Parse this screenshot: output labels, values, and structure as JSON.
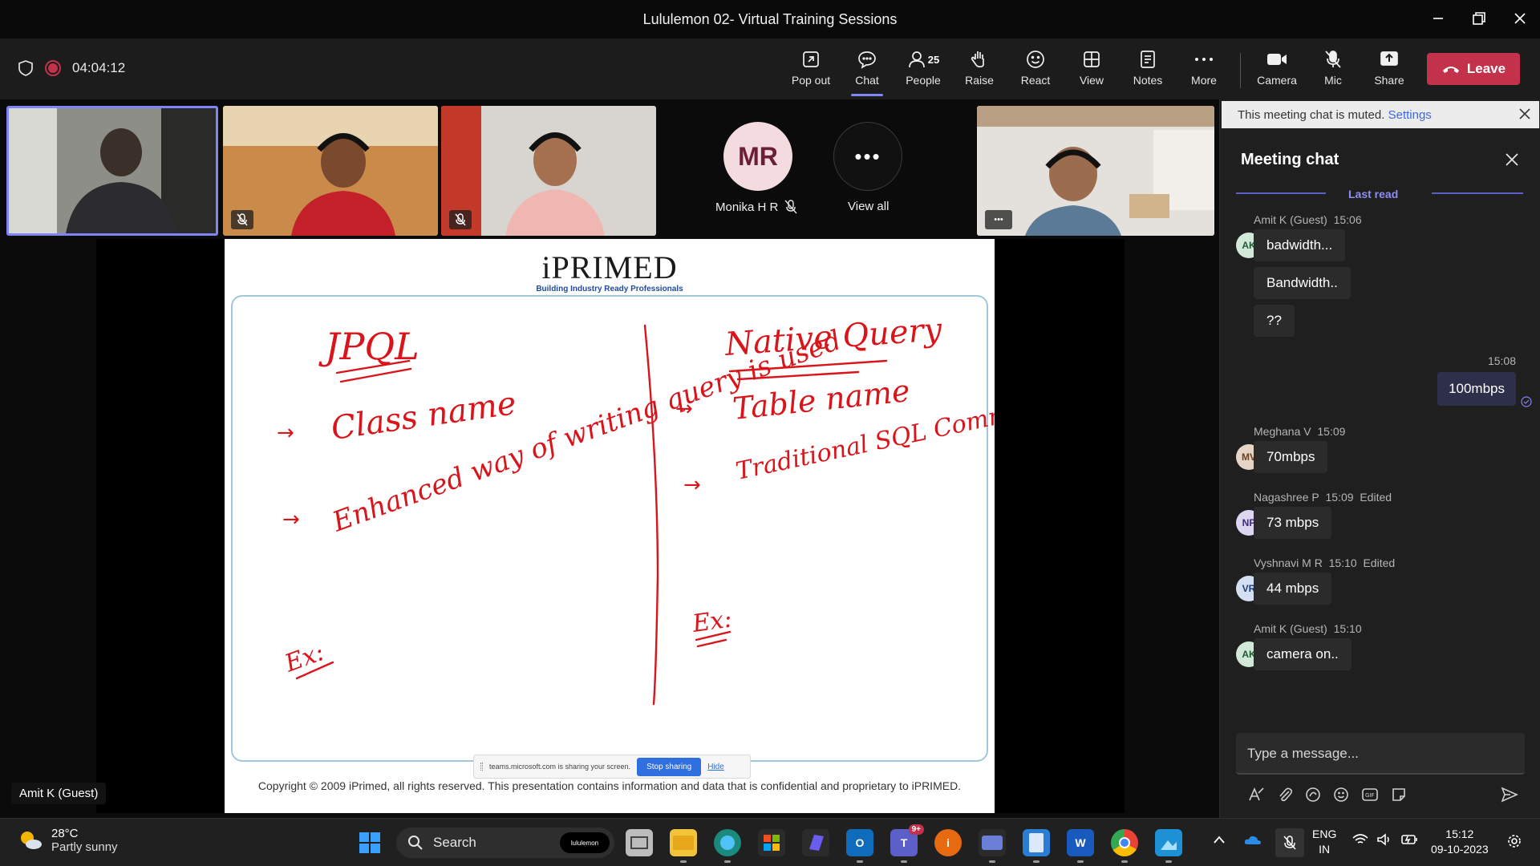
{
  "window": {
    "title": "Lululemon 02- Virtual Training Sessions"
  },
  "toolbar": {
    "timer": "04:04:12",
    "buttons": {
      "popout": "Pop out",
      "chat": "Chat",
      "people": "People",
      "people_count": "25",
      "raise": "Raise",
      "react": "React",
      "view": "View",
      "notes": "Notes",
      "more": "More",
      "camera": "Camera",
      "mic": "Mic",
      "share": "Share"
    },
    "leave": "Leave",
    "colors": {
      "leave": "#c4314b",
      "accent": "#7f85f5"
    }
  },
  "strip": {
    "participant_initials": "MR",
    "participant_name": "Monika H R",
    "view_all": "View all"
  },
  "stage": {
    "speaker_badge": "Amit K (Guest)",
    "slide": {
      "brand": "iPRIMED",
      "tagline": "Building Industry Ready Professionals",
      "copyright": "Copyright © 2009 iPrimed, all rights reserved. This presentation contains information  and data  that is confidential and proprietary to iPRIMED.",
      "handwriting": {
        "left_title": "JPQL",
        "left_1": "Class name",
        "left_2": "Enhanced way of writing query is used",
        "left_ex": "Ex:",
        "right_title": "Native Query",
        "right_1": "Table name",
        "right_2": "Traditional SQL Commands can be used",
        "right_ex": "Ex:"
      }
    },
    "sharebar": {
      "text": "teams.microsoft.com is sharing your screen.",
      "stop": "Stop sharing",
      "hide": "Hide"
    }
  },
  "chat": {
    "banner_text": "This meeting chat is muted.",
    "banner_link": "Settings",
    "title": "Meeting chat",
    "last_read": "Last read",
    "messages": [
      {
        "author": "Amit K (Guest)",
        "time": "15:06",
        "initials": "AK",
        "edited": "",
        "lines": [
          "badwidth...",
          "Bandwidth..",
          "??"
        ]
      },
      {
        "author": "",
        "time": "15:08",
        "initials": "",
        "edited": "",
        "lines": [
          "100mbps"
        ]
      },
      {
        "author": "Meghana V",
        "time": "15:09",
        "initials": "MV",
        "edited": "",
        "lines": [
          "70mbps"
        ]
      },
      {
        "author": "Nagashree P",
        "time": "15:09",
        "initials": "NP",
        "edited": "Edited",
        "lines": [
          "73 mbps"
        ]
      },
      {
        "author": "Vyshnavi M R",
        "time": "15:10",
        "initials": "VR",
        "edited": "Edited",
        "lines": [
          "44 mbps"
        ]
      },
      {
        "author": "Amit K (Guest)",
        "time": "15:10",
        "initials": "AK",
        "edited": "",
        "lines": [
          "camera on.."
        ]
      }
    ],
    "composer_placeholder": "Type a message..."
  },
  "taskbar": {
    "weather_temp": "28°C",
    "weather_desc": "Partly sunny",
    "search": "Search",
    "search_pill": "lululemon",
    "teams_badge": "9+",
    "lang_1": "ENG",
    "lang_2": "IN",
    "time": "15:12",
    "date": "09-10-2023"
  }
}
